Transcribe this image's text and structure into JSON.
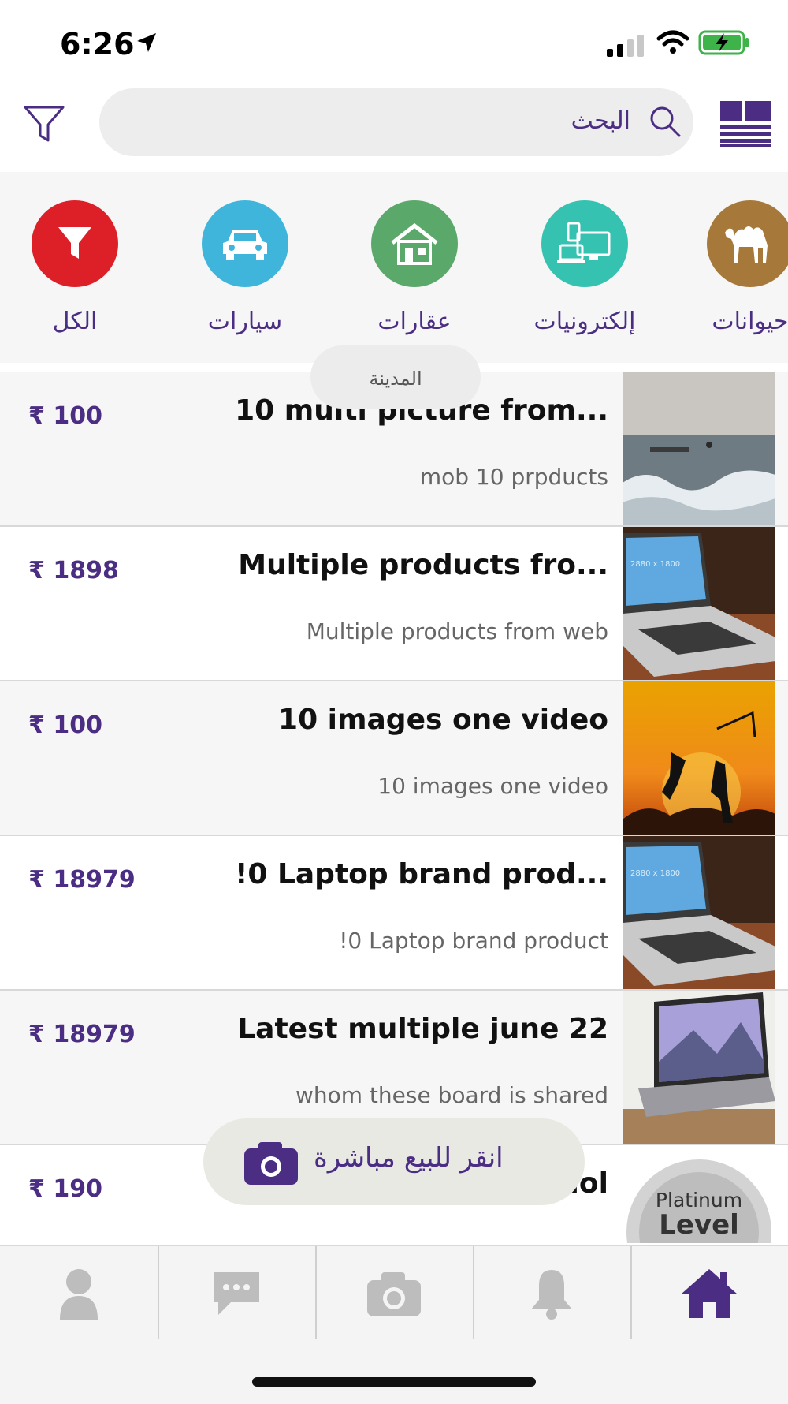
{
  "status_bar": {
    "time": "6:26"
  },
  "header": {
    "search_placeholder": "البحث"
  },
  "categories": [
    {
      "label": "الكل",
      "color": "#dd2028",
      "icon": "funnel-icon"
    },
    {
      "label": "سيارات",
      "color": "#3fb5dc",
      "icon": "car-icon"
    },
    {
      "label": "عقارات",
      "color": "#5aa86a",
      "icon": "house-icon"
    },
    {
      "label": "إلكترونيات",
      "color": "#35c2b0",
      "icon": "devices-icon"
    },
    {
      "label": "حيوانات",
      "color": "#a6793a",
      "icon": "camel-icon"
    }
  ],
  "city_filter": {
    "label": "المدينة"
  },
  "listings": [
    {
      "title": "10 multi picture from...",
      "subtitle": "mob 10 prpducts",
      "price": "₹ 100"
    },
    {
      "title": "Multiple products fro...",
      "subtitle": "Multiple products from web",
      "price": "₹ 1898"
    },
    {
      "title": "10 images one video",
      "subtitle": "10 images one video",
      "price": "₹ 100"
    },
    {
      "title": "!0 Laptop brand prod...",
      "subtitle": "!0 Laptop brand product",
      "price": "₹ 18979"
    },
    {
      "title": "Latest multiple june 22",
      "subtitle": "whom these board is shared",
      "price": "₹ 18979"
    },
    {
      "title": "...dol",
      "subtitle": "",
      "price": "₹ 190"
    }
  ],
  "sell_button": {
    "label": "انقر للبيع مباشرة"
  },
  "badge": {
    "line1": "Platinum",
    "line2": "Level"
  },
  "thumb_text": {
    "mock": "2880 x 1800"
  },
  "colors": {
    "brand_purple": "#4b2e83",
    "tab_inactive": "#bdbdbd"
  }
}
